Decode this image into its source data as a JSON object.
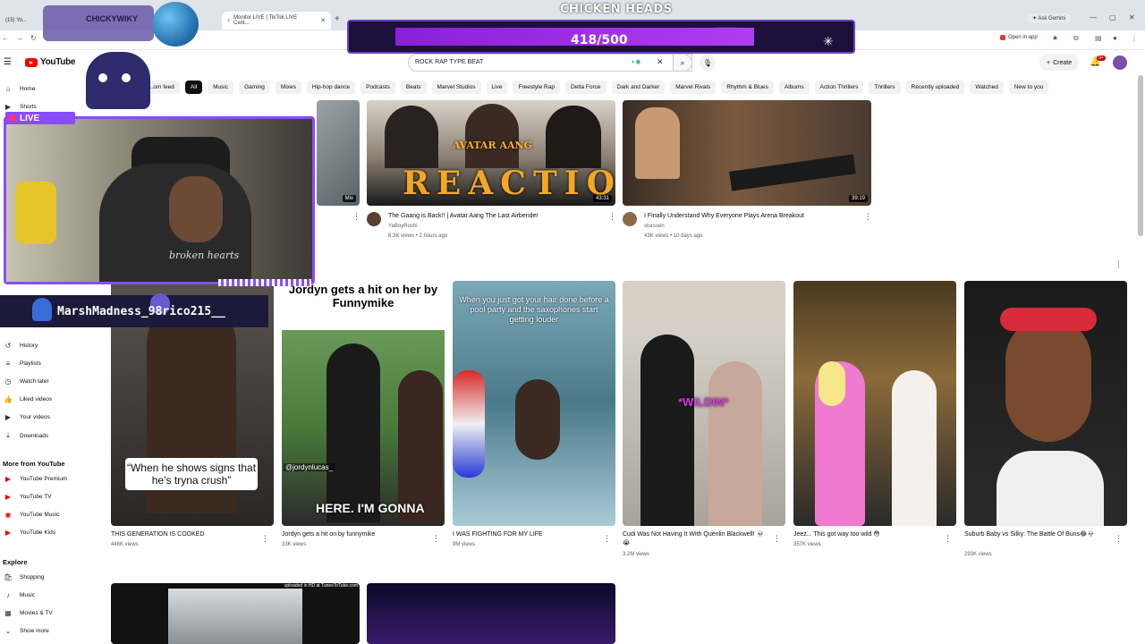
{
  "browser": {
    "tabs": [
      {
        "label": "(15) Yo..."
      },
      {
        "label": "Monitor LIVE | TikTok LIVE Cent..."
      }
    ],
    "ask_gemini": "Ask Gemini",
    "open_in_app": "Open in app"
  },
  "overlay": {
    "streamer_name": "CHICKYWIKY",
    "goal_title": "CHICKEN HEADS",
    "goal_count": "418/500",
    "goal_progress": 0.836,
    "live_label": "LIVE",
    "ticker_text": "MarshMadness_98rico215__",
    "shirt_text": "broken hearts",
    "accent": "#8a4cff"
  },
  "youtube": {
    "logo_text": "YouTube",
    "search_value": "ROCK RAP TYPE BEAT",
    "create_label": "Create",
    "notif_count": "9+",
    "chips": [
      "...om feed",
      "All",
      "Music",
      "Gaming",
      "Mixes",
      "Hip-hop dance",
      "Podcasts",
      "Beats",
      "Marvel Studios",
      "Live",
      "Freestyle Rap",
      "Delta Force",
      "Dark and Darker",
      "Marvel Rivals",
      "Rhythm & Blues",
      "Albums",
      "Action Thrillers",
      "Thrillers",
      "Recently uploaded",
      "Watched",
      "New to you"
    ],
    "sidebar": {
      "home": "Home",
      "shorts": "Shorts",
      "history": "History",
      "playlists": "Playlists",
      "watch_later": "Watch later",
      "liked": "Liked videos",
      "your_videos": "Your videos",
      "downloads": "Downloads",
      "more_header": "More from YouTube",
      "premium": "YouTube Premium",
      "tv": "YouTube TV",
      "music": "YouTube Music",
      "kids": "YouTube Kids",
      "explore_header": "Explore",
      "shopping": "Shopping",
      "explore_music": "Music",
      "movies": "Movies & TV",
      "show_more": "Show more"
    },
    "videos": [
      {
        "title": "The Gaang is Back!! | Avatar Aang The Last Airbender",
        "channel": "YaBoyRoshi",
        "meta": "8.3K views • 2 hours ago",
        "duration": "43:31",
        "thumb_text_top": "AVATAR AANG",
        "thumb_text": "REACTION"
      },
      {
        "title": "I Finally Understand Why Everyone Plays Arena Breakout",
        "channel": "sturssen",
        "meta": "43K views • 10 days ago",
        "duration": "39:19"
      },
      {
        "mix_label": "Mix"
      }
    ],
    "shorts": [
      {
        "title": "THIS GENERATION IS COOKED",
        "views": "446K views",
        "caption": "“When he shows signs that he’s tryna crush”"
      },
      {
        "title": "Jordyn gets a hit on by funnymike",
        "views": "33K views",
        "caption_top": "Jordyn gets a hit on her by Funnymike",
        "handle": "@jordynlucas_",
        "caption_bottom": "HERE. I'M GONNA"
      },
      {
        "title": "I WAS FIGHTING FOR MY LIFE",
        "views": "9M views",
        "caption_top": "When you just got your hair done before a pool party and the saxophones start getting louder"
      },
      {
        "title": "Cudi Was Not Having It With Quenlin Blackwell! 💀😭",
        "views": "3.2M views",
        "caption": "*WILDIN*"
      },
      {
        "title": "Jeez... This got way too wild 😳",
        "views": "357K views"
      },
      {
        "title": "Suburb Baby vs Silky: The Battle Of Buns😂💀",
        "views": "293K views"
      }
    ],
    "bottom_thumb_caption": "uploaded in HD at TunesToTube.com"
  }
}
